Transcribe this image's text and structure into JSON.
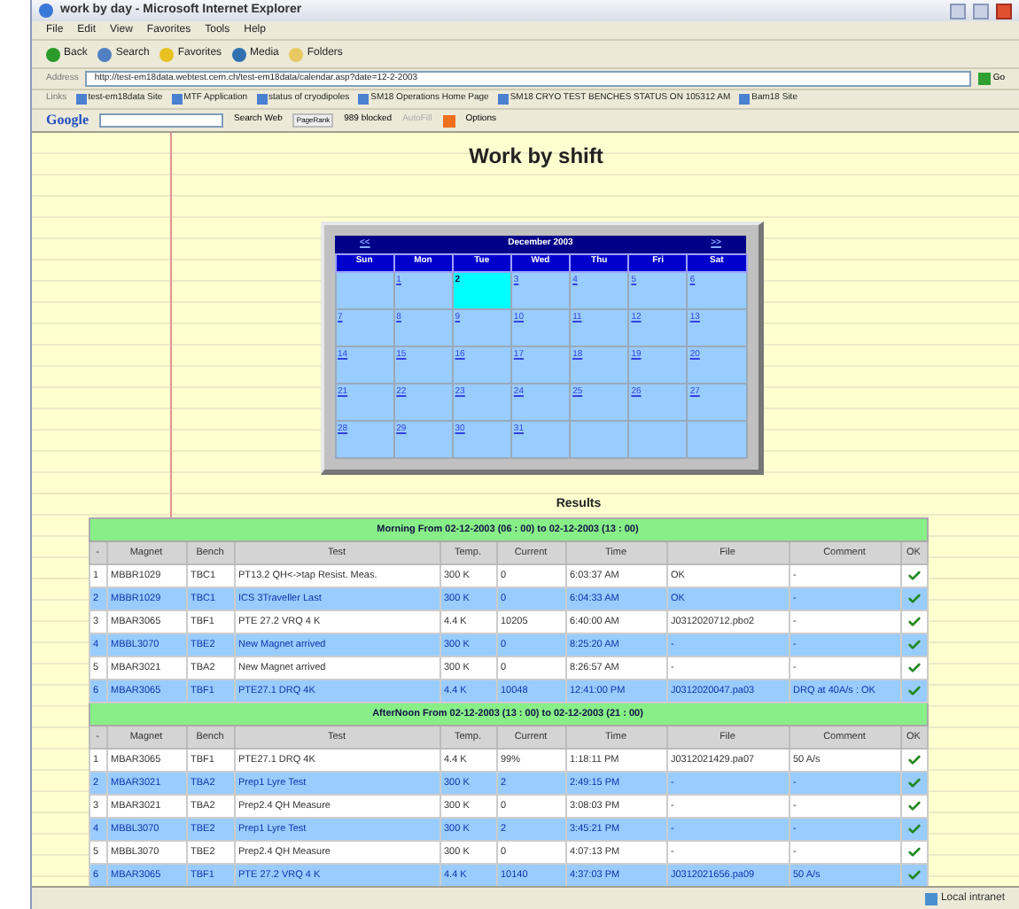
{
  "window": {
    "title": "work by day - Microsoft Internet Explorer"
  },
  "menu": [
    "File",
    "Edit",
    "View",
    "Favorites",
    "Tools",
    "Help"
  ],
  "toolbar": [
    "Back",
    "Search",
    "Favorites",
    "Media",
    "Folders"
  ],
  "address": {
    "label": "Address",
    "value": "http://test-em18data.webtest.cern.ch/test-em18data/calendar.asp?date=12-2-2003",
    "go": "Go"
  },
  "links": {
    "label": "Links",
    "items": [
      "test-em18data Site",
      "MTF Application",
      "status of cryodipoles",
      "SM18 Operations Home Page",
      "SM18 CRYO TEST BENCHES STATUS ON 105312 AM",
      "Bam18 Site"
    ]
  },
  "google_bar": {
    "logo": "Google",
    "search": "Search Web",
    "pagerank": "PageRank",
    "blocked": "989 blocked",
    "autofill": "AutoFill",
    "options": "Options"
  },
  "page_title": "Work by shift",
  "calendar": {
    "prev": "<<",
    "next": ">>",
    "month": "December 2003",
    "weekdays": [
      "Sun",
      "Mon",
      "Tue",
      "Wed",
      "Thu",
      "Fri",
      "Sat"
    ],
    "weeks": [
      {
        "pad_start": true,
        "days": [
          {
            "day": "1",
            "selected": false
          },
          {
            "day": "2",
            "selected": true
          },
          {
            "day": "3",
            "selected": false
          },
          {
            "day": "4",
            "selected": false
          },
          {
            "day": "5",
            "selected": false
          },
          {
            "day": "6",
            "selected": false
          }
        ]
      },
      {
        "days": [
          {
            "day": "7",
            "selected": false
          },
          {
            "day": "8",
            "selected": false
          },
          {
            "day": "9",
            "selected": false
          },
          {
            "day": "10",
            "selected": false
          },
          {
            "day": "11",
            "selected": false
          },
          {
            "day": "12",
            "selected": false
          },
          {
            "day": "13",
            "selected": false
          }
        ]
      },
      {
        "days": [
          {
            "day": "14",
            "selected": false
          },
          {
            "day": "15",
            "selected": false
          },
          {
            "day": "16",
            "selected": false
          },
          {
            "day": "17",
            "selected": false
          },
          {
            "day": "18",
            "selected": false
          },
          {
            "day": "19",
            "selected": false
          },
          {
            "day": "20",
            "selected": false
          }
        ]
      },
      {
        "days": [
          {
            "day": "21",
            "selected": false
          },
          {
            "day": "22",
            "selected": false
          },
          {
            "day": "23",
            "selected": false
          },
          {
            "day": "24",
            "selected": false
          },
          {
            "day": "25",
            "selected": false
          },
          {
            "day": "26",
            "selected": false
          },
          {
            "day": "27",
            "selected": false
          }
        ]
      },
      {
        "pad_start": false,
        "days": [
          {
            "day": "28",
            "selected": false
          },
          {
            "day": "29",
            "selected": false
          },
          {
            "day": "30",
            "selected": false
          },
          {
            "day": "31",
            "selected": false
          }
        ]
      }
    ]
  },
  "results": {
    "title": "Results",
    "shifts": [
      {
        "title": "Morning From 02-12-2003 (06 : 00) to 02-12-2003 (13 : 00)",
        "columns": [
          "-",
          "Magnet",
          "Bench",
          "Test",
          "Temp.",
          "Current",
          "Time",
          "File",
          "Comment",
          "OK"
        ],
        "rows": [
          {
            "cells": [
              "1",
              "MBBR1029",
              "TBC1",
              "PT13.2 QH<->tap Resist. Meas.",
              "300 K",
              "0",
              "6:03:37 AM",
              "OK",
              "-"
            ],
            "ok": true
          },
          {
            "cells": [
              "2",
              "MBBR1029",
              "TBC1",
              "ICS 3Traveller Last",
              "300 K",
              "0",
              "6:04:33 AM",
              "OK",
              "-"
            ],
            "ok": true
          },
          {
            "cells": [
              "3",
              "MBAR3065",
              "TBF1",
              "PTE 27.2 VRQ 4 K",
              "4.4 K",
              "10205",
              "6:40:00 AM",
              "J0312020712.pbo2",
              "-"
            ],
            "ok": true
          },
          {
            "cells": [
              "4",
              "MBBL3070",
              "TBE2",
              "New Magnet arrived",
              "300 K",
              "0",
              "8:25:20 AM",
              "-",
              "-"
            ],
            "ok": true
          },
          {
            "cells": [
              "5",
              "MBAR3021",
              "TBA2",
              "New Magnet arrived",
              "300 K",
              "0",
              "8:26:57 AM",
              "-",
              "-"
            ],
            "ok": true
          },
          {
            "cells": [
              "6",
              "MBAR3065",
              "TBF1",
              "PTE27.1 DRQ 4K",
              "4.4 K",
              "10048",
              "12:41:00 PM",
              "J0312020047.pa03",
              "DRQ at 40A/s : OK"
            ],
            "ok": true
          }
        ]
      },
      {
        "title": "AfterNoon From 02-12-2003 (13 : 00) to 02-12-2003 (21 : 00)",
        "columns": [
          "-",
          "Magnet",
          "Bench",
          "Test",
          "Temp.",
          "Current",
          "Time",
          "File",
          "Comment",
          "OK"
        ],
        "rows": [
          {
            "cells": [
              "1",
              "MBAR3065",
              "TBF1",
              "PTE27.1 DRQ 4K",
              "4.4 K",
              "99%",
              "1:18:11 PM",
              "J0312021429.pa07",
              "50 A/s"
            ],
            "ok": true
          },
          {
            "cells": [
              "2",
              "MBAR3021",
              "TBA2",
              "Prep1 Lyre Test",
              "300 K",
              "2",
              "2:49:15 PM",
              "-",
              "-"
            ],
            "ok": true
          },
          {
            "cells": [
              "3",
              "MBAR3021",
              "TBA2",
              "Prep2.4 QH Measure",
              "300 K",
              "0",
              "3:08:03 PM",
              "-",
              "-"
            ],
            "ok": true
          },
          {
            "cells": [
              "4",
              "MBBL3070",
              "TBE2",
              "Prep1 Lyre Test",
              "300 K",
              "2",
              "3:45:21 PM",
              "-",
              "-"
            ],
            "ok": true
          },
          {
            "cells": [
              "5",
              "MBBL3070",
              "TBE2",
              "Prep2.4 QH Measure",
              "300 K",
              "0",
              "4:07:13 PM",
              "-",
              "-"
            ],
            "ok": true
          },
          {
            "cells": [
              "6",
              "MBAR3065",
              "TBF1",
              "PTE 27.2 VRQ 4 K",
              "4.4 K",
              "10140",
              "4:37:03 PM",
              "J0312021656.pa09",
              "50 A/s"
            ],
            "ok": true
          }
        ]
      }
    ]
  },
  "status_bar": {
    "zone": "Local intranet"
  }
}
